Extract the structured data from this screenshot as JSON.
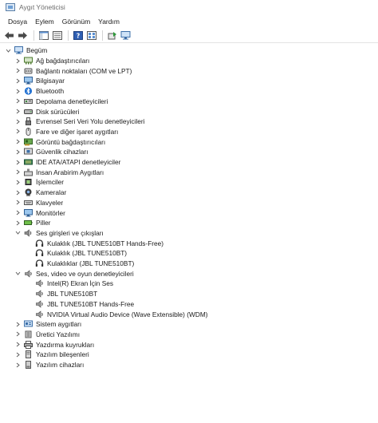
{
  "window": {
    "title": "Aygıt Yöneticisi"
  },
  "menu": [
    "Dosya",
    "Eylem",
    "Görünüm",
    "Yardım"
  ],
  "tree": [
    {
      "label": "Begüm",
      "level": 0,
      "expanded": true,
      "icon": "computer-icon"
    },
    {
      "label": "Ağ bağdaştırıcıları",
      "level": 1,
      "expanded": false,
      "icon": "network-adapter-icon"
    },
    {
      "label": "Bağlantı noktaları (COM ve LPT)",
      "level": 1,
      "expanded": false,
      "icon": "port-icon"
    },
    {
      "label": "Bilgisayar",
      "level": 1,
      "expanded": false,
      "icon": "monitor-icon"
    },
    {
      "label": "Bluetooth",
      "level": 1,
      "expanded": false,
      "icon": "bluetooth-icon"
    },
    {
      "label": "Depolama denetleyicileri",
      "level": 1,
      "expanded": false,
      "icon": "storage-controller-icon"
    },
    {
      "label": "Disk sürücüleri",
      "level": 1,
      "expanded": false,
      "icon": "disk-drive-icon"
    },
    {
      "label": "Evrensel Seri Veri Yolu denetleyicileri",
      "level": 1,
      "expanded": false,
      "icon": "usb-icon"
    },
    {
      "label": "Fare ve diğer işaret aygıtları",
      "level": 1,
      "expanded": false,
      "icon": "mouse-icon"
    },
    {
      "label": "Görüntü bağdaştırıcıları",
      "level": 1,
      "expanded": false,
      "icon": "display-adapter-icon"
    },
    {
      "label": "Güvenlik cihazları",
      "level": 1,
      "expanded": false,
      "icon": "security-device-icon"
    },
    {
      "label": "IDE ATA/ATAPI denetleyiciler",
      "level": 1,
      "expanded": false,
      "icon": "ide-controller-icon"
    },
    {
      "label": "İnsan Arabirim Aygıtları",
      "level": 1,
      "expanded": false,
      "icon": "hid-icon"
    },
    {
      "label": "İşlemciler",
      "level": 1,
      "expanded": false,
      "icon": "processor-icon"
    },
    {
      "label": "Kameralar",
      "level": 1,
      "expanded": false,
      "icon": "camera-icon"
    },
    {
      "label": "Klavyeler",
      "level": 1,
      "expanded": false,
      "icon": "keyboard-icon"
    },
    {
      "label": "Monitörler",
      "level": 1,
      "expanded": false,
      "icon": "monitor-icon"
    },
    {
      "label": "Piller",
      "level": 1,
      "expanded": false,
      "icon": "battery-icon"
    },
    {
      "label": "Ses girişleri ve çıkışları",
      "level": 1,
      "expanded": true,
      "icon": "audio-io-icon"
    },
    {
      "label": "Kulaklık (JBL TUNE510BT Hands-Free)",
      "level": 2,
      "icon": "headset-icon"
    },
    {
      "label": "Kulaklık (JBL TUNE510BT)",
      "level": 2,
      "icon": "headset-icon"
    },
    {
      "label": "Kulaklıklar (JBL TUNE510BT)",
      "level": 2,
      "icon": "headset-icon"
    },
    {
      "label": "Ses, video ve oyun denetleyicileri",
      "level": 1,
      "expanded": true,
      "icon": "speaker-icon"
    },
    {
      "label": "Intel(R) Ekran İçin Ses",
      "level": 2,
      "icon": "speaker-icon"
    },
    {
      "label": "JBL TUNE510BT",
      "level": 2,
      "icon": "speaker-icon"
    },
    {
      "label": "JBL TUNE510BT Hands-Free",
      "level": 2,
      "icon": "speaker-icon"
    },
    {
      "label": "NVIDIA Virtual Audio Device (Wave Extensible) (WDM)",
      "level": 2,
      "icon": "speaker-icon"
    },
    {
      "label": "Sistem aygıtları",
      "level": 1,
      "expanded": false,
      "icon": "system-device-icon"
    },
    {
      "label": "Üretici Yazılımı",
      "level": 1,
      "expanded": false,
      "icon": "firmware-icon"
    },
    {
      "label": "Yazdırma kuyrukları",
      "level": 1,
      "expanded": false,
      "icon": "printer-icon"
    },
    {
      "label": "Yazılım bileşenleri",
      "level": 1,
      "expanded": false,
      "icon": "software-component-icon"
    },
    {
      "label": "Yazılım cihazları",
      "level": 1,
      "expanded": false,
      "icon": "software-device-icon"
    }
  ]
}
